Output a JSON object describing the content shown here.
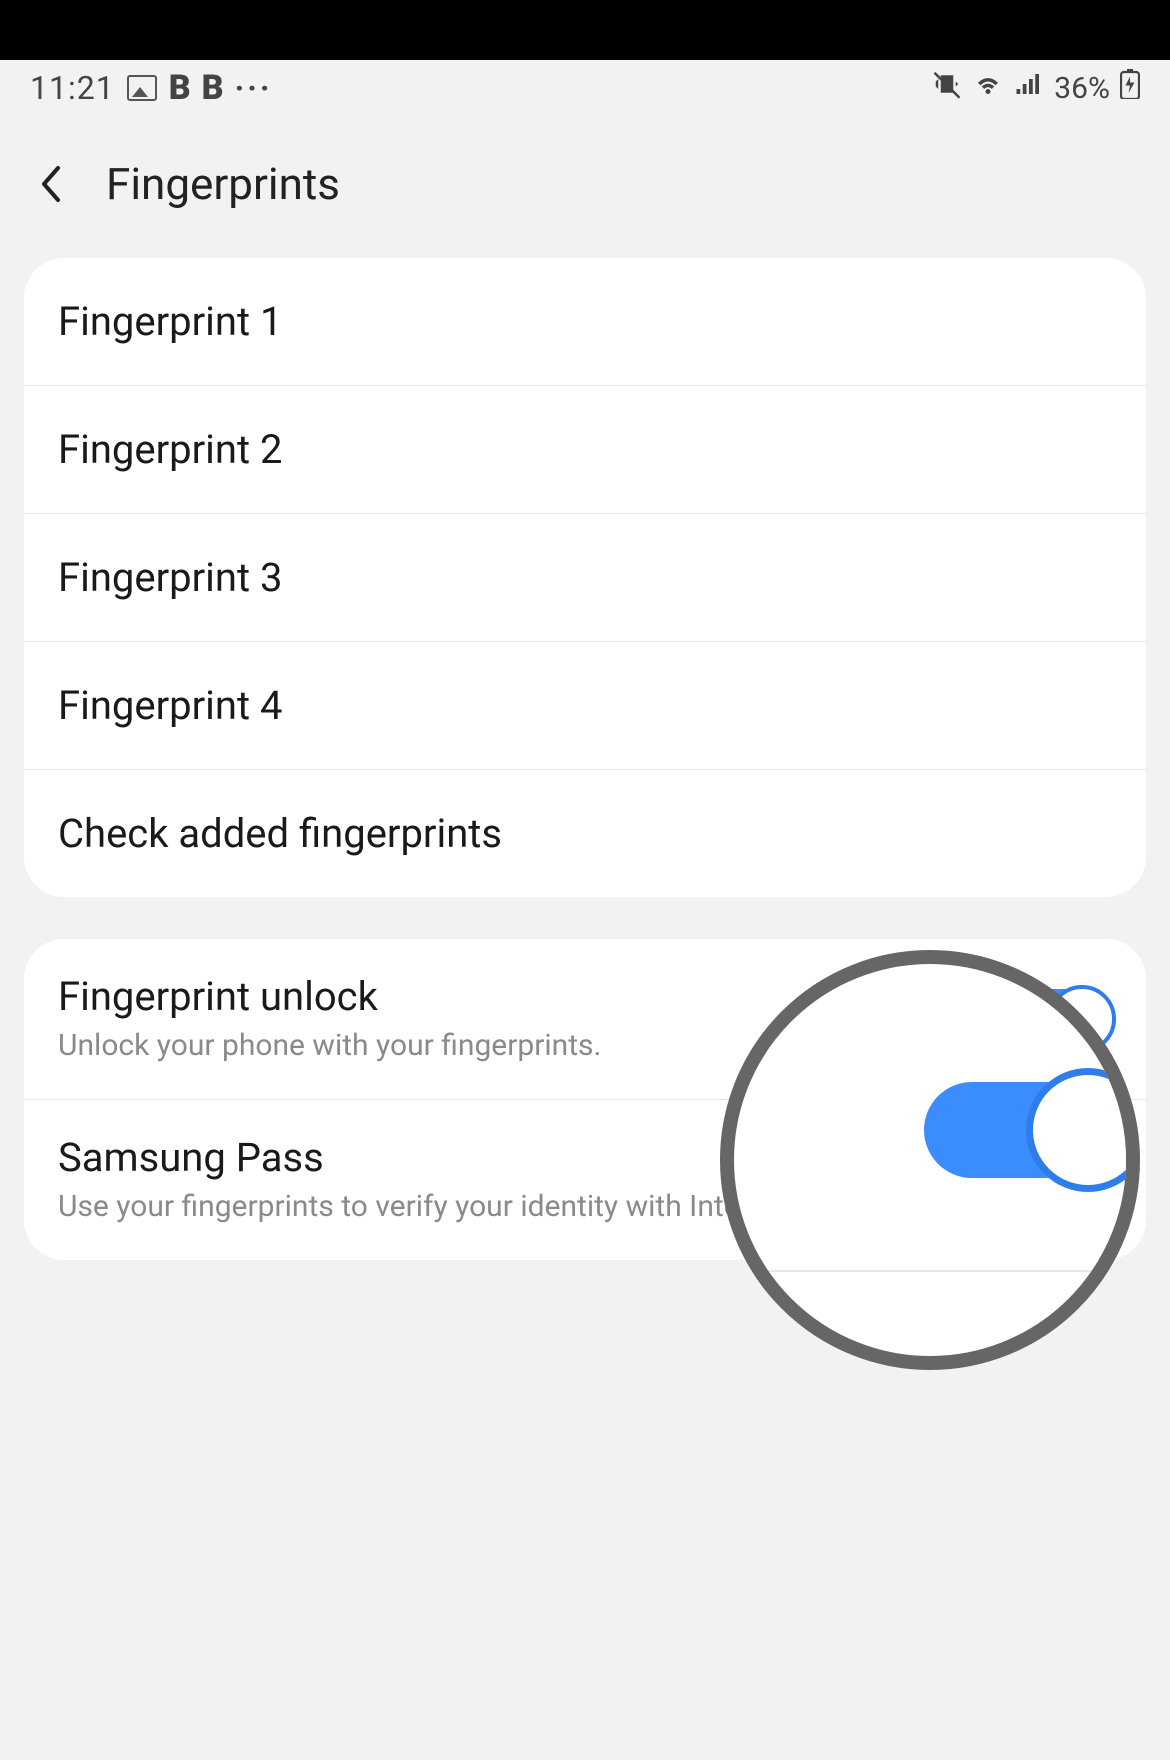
{
  "status_bar": {
    "time": "11:21",
    "app_indicator_1": "B",
    "app_indicator_2": "B",
    "more_dots": "···",
    "battery_pct": "36%"
  },
  "header": {
    "title": "Fingerprints"
  },
  "fingerprint_list": {
    "items": [
      {
        "label": "Fingerprint 1"
      },
      {
        "label": "Fingerprint 2"
      },
      {
        "label": "Fingerprint 3"
      },
      {
        "label": "Fingerprint 4"
      }
    ],
    "check_label": "Check added fingerprints"
  },
  "options": {
    "unlock": {
      "title": "Fingerprint unlock",
      "subtitle": "Unlock your phone with your fingerprints.",
      "enabled": true
    },
    "samsung_pass": {
      "title": "Samsung Pass",
      "subtitle": "Use your fingerprints to verify your identity with Internet and supported apps."
    }
  }
}
